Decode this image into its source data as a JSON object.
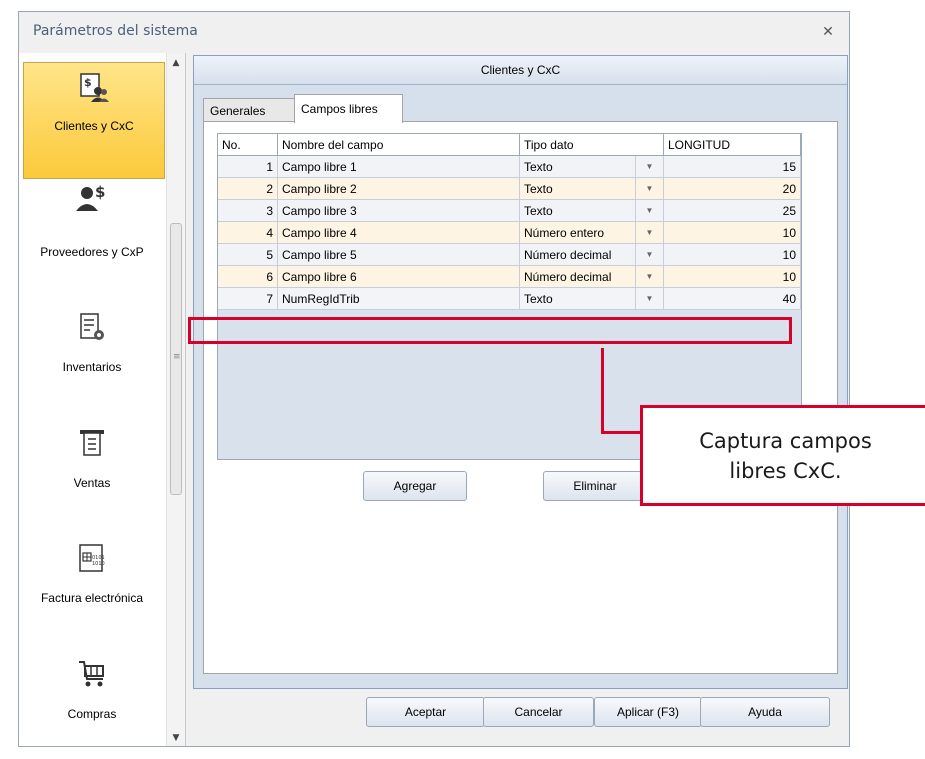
{
  "window": {
    "title": "Parámetros del sistema"
  },
  "nav": {
    "items": [
      {
        "label": "Clientes y CxC",
        "icon": "clients-icon",
        "selected": true
      },
      {
        "label": "Proveedores y CxP",
        "icon": "suppliers-icon"
      },
      {
        "label": "Inventarios",
        "icon": "inventory-icon"
      },
      {
        "label": "Ventas",
        "icon": "sales-icon"
      },
      {
        "label": "Factura electrónica",
        "icon": "e-invoice-icon"
      },
      {
        "label": "Compras",
        "icon": "cart-icon"
      }
    ]
  },
  "main": {
    "header": "Clientes y CxC",
    "tabs": [
      {
        "label": "Generales",
        "active": false
      },
      {
        "label": "Campos libres",
        "active": true
      }
    ],
    "grid": {
      "columns": [
        "No.",
        "Nombre del campo",
        "Tipo dato",
        "LONGITUD"
      ],
      "rows": [
        {
          "no": "1",
          "name": "Campo libre 1",
          "tipo": "Texto",
          "longitud": "15"
        },
        {
          "no": "2",
          "name": "Campo libre 2",
          "tipo": "Texto",
          "longitud": "20"
        },
        {
          "no": "3",
          "name": "Campo libre 3",
          "tipo": "Texto",
          "longitud": "25"
        },
        {
          "no": "4",
          "name": "Campo libre 4",
          "tipo": "Número entero",
          "longitud": "10"
        },
        {
          "no": "5",
          "name": "Campo libre 5",
          "tipo": "Número decimal",
          "longitud": "10"
        },
        {
          "no": "6",
          "name": "Campo libre 6",
          "tipo": "Número decimal",
          "longitud": "10"
        },
        {
          "no": "7",
          "name": "NumRegIdTrib",
          "tipo": "Texto",
          "longitud": "40"
        }
      ]
    },
    "buttons": {
      "add": "Agregar",
      "delete": "Eliminar"
    }
  },
  "footer": {
    "accept": "Aceptar",
    "cancel": "Cancelar",
    "apply": "Aplicar (F3)",
    "help": "Ayuda"
  },
  "callout": {
    "line1": "Captura campos",
    "line2": "libres CxC."
  },
  "colors": {
    "highlight": "#d6002a",
    "selected_nav": "#fcc93a"
  }
}
